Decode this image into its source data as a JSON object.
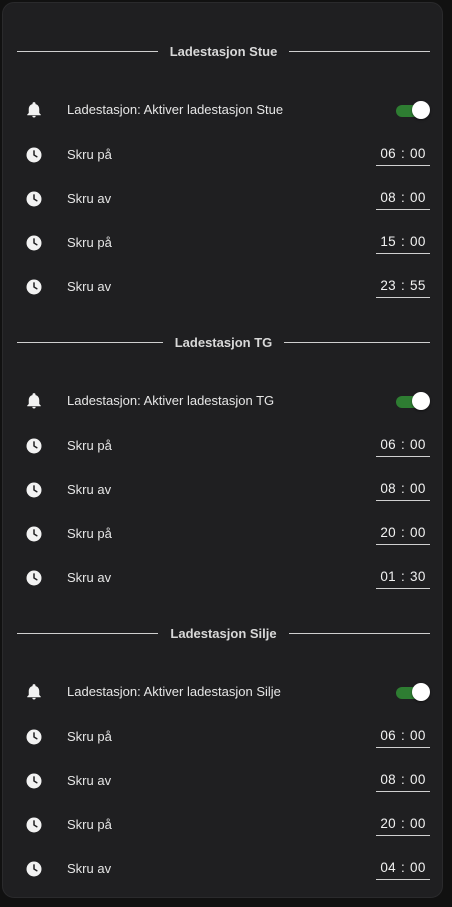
{
  "sections": [
    {
      "title": "Ladestasjon Stue",
      "toggle": {
        "label": "Ladestasjon: Aktiver ladestasjon Stue",
        "on": true,
        "icon": "bell-icon"
      },
      "times": [
        {
          "label": "Skru på",
          "hour": "06",
          "minute": "00",
          "icon": "clock-icon"
        },
        {
          "label": "Skru av",
          "hour": "08",
          "minute": "00",
          "icon": "clock-icon"
        },
        {
          "label": "Skru på",
          "hour": "15",
          "minute": "00",
          "icon": "clock-icon"
        },
        {
          "label": "Skru av",
          "hour": "23",
          "minute": "55",
          "icon": "clock-icon"
        }
      ]
    },
    {
      "title": "Ladestasjon TG",
      "toggle": {
        "label": "Ladestasjon: Aktiver ladestasjon TG",
        "on": true,
        "icon": "bell-icon"
      },
      "times": [
        {
          "label": "Skru på",
          "hour": "06",
          "minute": "00",
          "icon": "clock-icon"
        },
        {
          "label": "Skru av",
          "hour": "08",
          "minute": "00",
          "icon": "clock-icon"
        },
        {
          "label": "Skru på",
          "hour": "20",
          "minute": "00",
          "icon": "clock-icon"
        },
        {
          "label": "Skru av",
          "hour": "01",
          "minute": "30",
          "icon": "clock-icon"
        }
      ]
    },
    {
      "title": "Ladestasjon Silje",
      "toggle": {
        "label": "Ladestasjon: Aktiver ladestasjon Silje",
        "on": true,
        "icon": "bell-icon"
      },
      "times": [
        {
          "label": "Skru på",
          "hour": "06",
          "minute": "00",
          "icon": "clock-icon"
        },
        {
          "label": "Skru av",
          "hour": "08",
          "minute": "00",
          "icon": "clock-icon"
        },
        {
          "label": "Skru på",
          "hour": "20",
          "minute": "00",
          "icon": "clock-icon"
        },
        {
          "label": "Skru av",
          "hour": "04",
          "minute": "00",
          "icon": "clock-icon"
        }
      ]
    }
  ],
  "time_separator": ":",
  "colors": {
    "card_background": "#1f1f21",
    "page_background": "#111111",
    "toggle_on": "#2e7d32",
    "text": "#e6e6e6"
  }
}
